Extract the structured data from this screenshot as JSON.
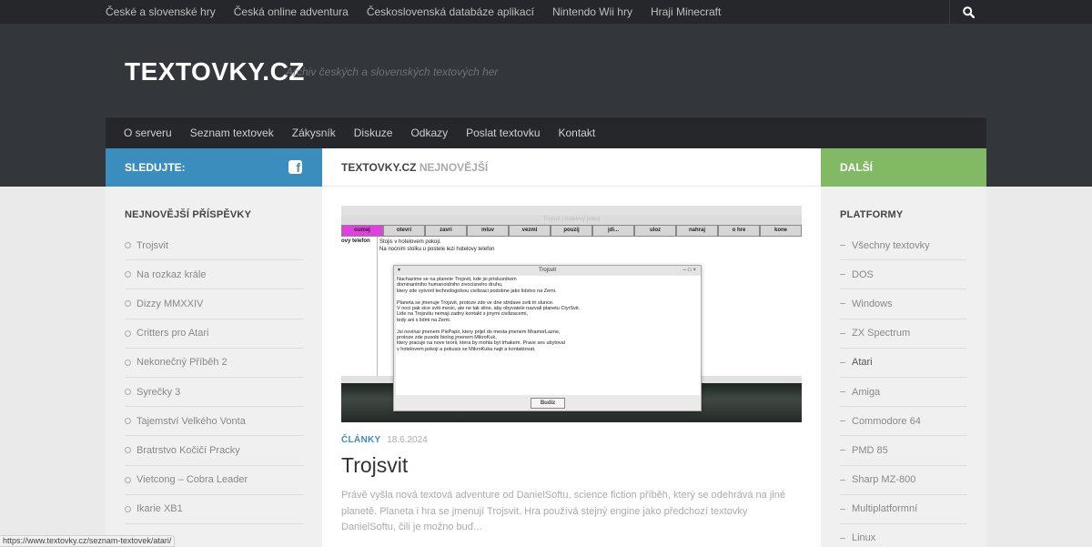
{
  "top_nav": [
    "České a slovenské hry",
    "Česká online adventura",
    "Československá databáze aplikací",
    "Nintendo Wii hry",
    "Hraji Minecraft"
  ],
  "site": {
    "title": "TEXTOVKY.CZ",
    "description": "Archiv českých a slovenských textových her"
  },
  "main_nav": [
    "O serveru",
    "Seznam textovek",
    "Zákysník",
    "Diskuze",
    "Odkazy",
    "Poslat textovku",
    "Kontakt"
  ],
  "left_sidebar": {
    "header": "SLEDUJTE:",
    "widget_title": "NEJNOVĚJŠÍ PŘÍSPĚVKY",
    "items": [
      "Trojsvit",
      "Na rozkaz krále",
      "Dizzy MMXXIV",
      "Critters pro Atari",
      "Nekonečný Příběh 2",
      "Syrečky 3",
      "Tajemství Velkého Vonta",
      "Bratrstvo Kočičí Pracky",
      "Vietcong – Cobra Leader",
      "Ikarie XB1"
    ]
  },
  "main": {
    "header_a": "TEXTOVKY.CZ",
    "header_b": "NEJNOVĚJŠÍ",
    "thumb": {
      "window_title": "Trojsvit | hotelový pokoj",
      "toolbar": [
        "oumej",
        "otevri",
        "zavri",
        "mluv",
        "vezmi",
        "pouzij",
        "jdi...",
        "uloz",
        "nahraj",
        "o hre",
        "kone"
      ],
      "left_label": "ovy telefon",
      "room_text": "Stojis v hotelovem pokoji.\nNa nocnim stolku u postele lezi hotelovy telefon",
      "dialog_title": "Trojsvit",
      "dialog_text": "Nachazime se na planete Trojsvit, kde jsi prislusnikem\ndominantniho humanoidniho zivocisneho druhu,\nktery zde vytvoril technologickou civilizaci podobne jako lidstvo na Zemi.\n\nPlaneta se jmenuje Trojsvit, protoze zde ve dne stridave sviti tri slunce.\nV noci pak sice sviti mesic, ale ne tak silne, aby obyvatele nazvali planetu CtyrSvit.\nLide na Trojsvitu nemaji zadny kontakt s jinymi civilizacemi,\ntedy ani s lidmi na Zemi.\n\nJsi novinar jmenem PisPapir, ktery prijel do mesta jmenem MramorLazne,\nprotoze zde pusobi biolog jmenem MikroKuk,\nktery pracuje na nove teorii, ktera by mohla byt trhakem. Prave ses ubytoval\nv hotelovem pokoji a pokusis se MikroKuka najit a kontaktovat.",
      "dialog_button": "Budiz"
    },
    "category": "ČLÁNKY",
    "date": "18.6.2024",
    "post_title": "Trojsvit",
    "excerpt": "Právě vyšla nová textová adventure od DanielSoftu, science fiction příběh, který se odehrává na jiné planetě. Planeta i hra se jmenují Trojsvit. Hra používá stejný engine jako předchozí textovky DanielSoftu, čili je možno buď..."
  },
  "right_sidebar": {
    "header": "DALŠÍ",
    "widget_title": "PLATFORMY",
    "items": [
      "Všechny textovky",
      "DOS",
      "Windows",
      "ZX Spectrum",
      "Atari",
      "Amiga",
      "Commodore 64",
      "PMD 85",
      "Sharp MZ-800",
      "Multiplatformní",
      "Linux"
    ]
  },
  "status_url": "https://www.textovky.cz/seznam-textovek/atari/",
  "colors": {
    "blue": "#3b8dbd",
    "green": "#82b965",
    "dark": "#26272b",
    "header": "#33363b"
  },
  "icons": {
    "search": "search-icon",
    "facebook": "facebook-icon"
  }
}
